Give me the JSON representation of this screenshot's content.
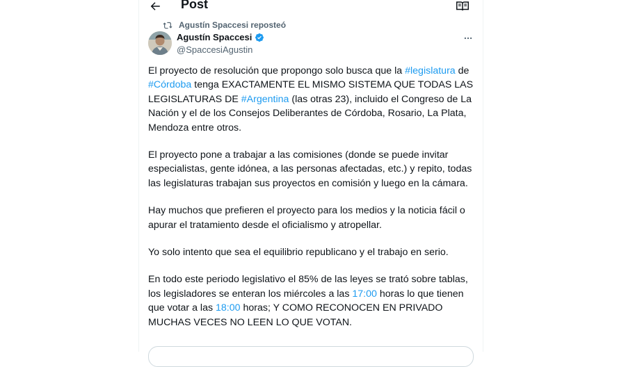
{
  "header": {
    "title": "Post"
  },
  "repost": {
    "label": "Agustín Spaccesi reposteó"
  },
  "author": {
    "name": "Agustín Spaccesi",
    "handle": "@SpaccesiAgustin"
  },
  "tweet": {
    "p1": {
      "t1": "El proyecto de resolución que propongo solo busca que la ",
      "h1": "#legislatura",
      "t2": " de ",
      "h2": "#Córdoba",
      "t3": " tenga EXACTAMENTE EL MISMO SISTEMA QUE TODAS LAS LEGISLATURAS DE ",
      "h3": "#Argentina",
      "t4": " (las otras 23), incluido el Congreso de La Nación y el de los Consejos Deliberantes de Córdoba, Rosario, La Plata, Mendoza entre otros."
    },
    "p2": "El proyecto pone a trabajar a las comisiones (donde se puede invitar especialistas, gente idónea, a las personas afectadas, etc.) y repito, todas las legislaturas trabajan sus proyectos en comisión y luego en la cámara.",
    "p3": "Hay muchos que prefieren el proyecto para los medios y la noticia fácil o apurar el tratamiento desde el oficialismo y atropellar.",
    "p4": "Yo solo intento que sea el equilibrio republicano y el trabajo en serio.",
    "p5": {
      "t1": "En todo este periodo legislativo el 85% de las leyes se trató sobre tablas, los legisladores se enteran los miércoles a las ",
      "time1": "17:00",
      "t2": " horas lo que tienen que votar a las ",
      "time2": "18:00",
      "t3": " horas; Y COMO RECONOCEN EN PRIVADO MUCHAS VECES NO LEEN LO QUE VOTAN."
    }
  },
  "colors": {
    "link": "#1d9bf0",
    "verified": "#1d9bf0",
    "muted": "#536471"
  }
}
